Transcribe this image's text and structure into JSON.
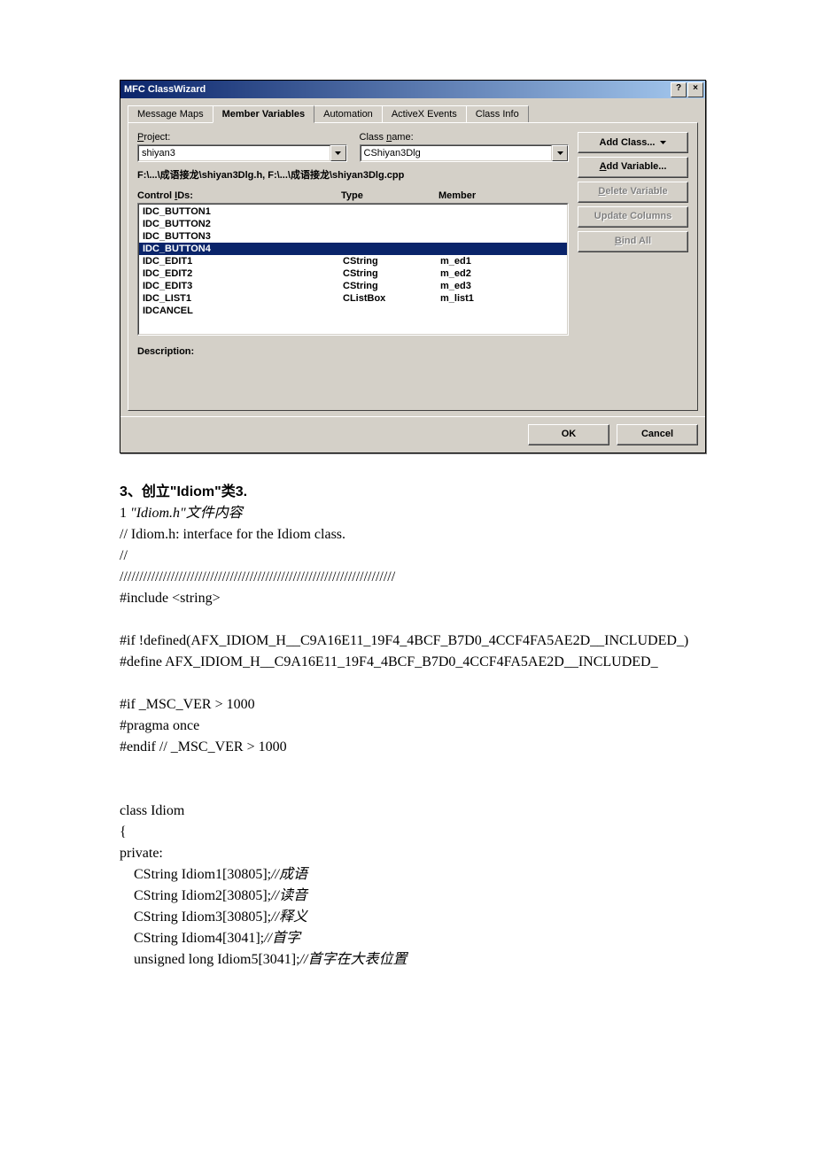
{
  "dialog": {
    "title": "MFC ClassWizard",
    "help_btn": "?",
    "close_btn": "×",
    "tabs": [
      "Message Maps",
      "Member Variables",
      "Automation",
      "ActiveX Events",
      "Class Info"
    ],
    "active_tab": 1,
    "project_label": "Project:",
    "project_value": "shiyan3",
    "class_label": "Class name:",
    "class_value": "CShiyan3Dlg",
    "path": "F:\\...\\成语接龙\\shiyan3Dlg.h, F:\\...\\成语接龙\\shiyan3Dlg.cpp",
    "control_ids_label": "Control IDs:",
    "type_label": "Type",
    "member_label": "Member",
    "list": [
      {
        "id": "IDC_BUTTON1",
        "type": "",
        "member": "",
        "selected": false
      },
      {
        "id": "IDC_BUTTON2",
        "type": "",
        "member": "",
        "selected": false
      },
      {
        "id": "IDC_BUTTON3",
        "type": "",
        "member": "",
        "selected": false
      },
      {
        "id": "IDC_BUTTON4",
        "type": "",
        "member": "",
        "selected": true
      },
      {
        "id": "IDC_EDIT1",
        "type": "CString",
        "member": "m_ed1",
        "selected": false
      },
      {
        "id": "IDC_EDIT2",
        "type": "CString",
        "member": "m_ed2",
        "selected": false
      },
      {
        "id": "IDC_EDIT3",
        "type": "CString",
        "member": "m_ed3",
        "selected": false
      },
      {
        "id": "IDC_LIST1",
        "type": "CListBox",
        "member": "m_list1",
        "selected": false
      },
      {
        "id": "IDCANCEL",
        "type": "",
        "member": "",
        "selected": false
      }
    ],
    "desc_label": "Description:",
    "buttons": {
      "add_class": "Add Class...",
      "add_variable": "Add Variable...",
      "delete_variable": "Delete Variable",
      "update_columns": "Update Columns",
      "bind_all": "Bind All",
      "ok": "OK",
      "cancel": "Cancel"
    }
  },
  "doc": {
    "heading": "3、创立\"Idiom\"类3.",
    "line_a": "1 ",
    "line_a_italic": "\"Idiom.h\"文件内容",
    "code1": "// Idiom.h: interface for the Idiom class.\n//\n//////////////////////////////////////////////////////////////////////\n#include <string>\n\n#if !defined(AFX_IDIOM_H__C9A16E11_19F4_4BCF_B7D0_4CCF4FA5AE2D__INCLUDED_)\n#define AFX_IDIOM_H__C9A16E11_19F4_4BCF_B7D0_4CCF4FA5AE2D__INCLUDED_\n\n#if _MSC_VER > 1000\n#pragma once\n#endif // _MSC_VER > 1000\n\n\nclass Idiom\n{\nprivate:",
    "code2a": "    CString Idiom1[30805];",
    "code2a_c": "//成语",
    "code2b": "    CString Idiom2[30805];",
    "code2b_c": "//读音",
    "code2c": "    CString Idiom3[30805];",
    "code2c_c": "//释义",
    "code2d": "    CString Idiom4[3041];",
    "code2d_c": "//首字",
    "code2e": "    unsigned long Idiom5[3041];",
    "code2e_c": "//首字在大表位置"
  }
}
